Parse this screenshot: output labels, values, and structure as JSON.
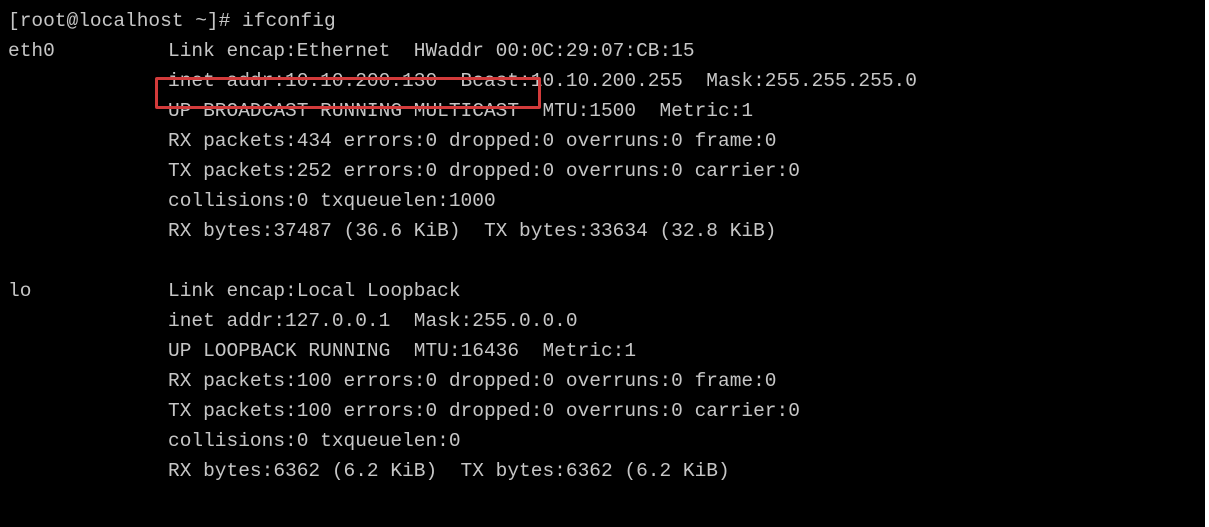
{
  "prompt": "[root@localhost ~]# ifconfig",
  "interfaces": [
    {
      "name": "eth0",
      "lines": [
        "Link encap:Ethernet  HWaddr 00:0C:29:07:CB:15",
        "inet addr:10.10.200.130  Bcast:10.10.200.255  Mask:255.255.255.0",
        "UP BROADCAST RUNNING MULTICAST  MTU:1500  Metric:1",
        "RX packets:434 errors:0 dropped:0 overruns:0 frame:0",
        "TX packets:252 errors:0 dropped:0 overruns:0 carrier:0",
        "collisions:0 txqueuelen:1000",
        "RX bytes:37487 (36.6 KiB)  TX bytes:33634 (32.8 KiB)"
      ]
    },
    {
      "name": "lo",
      "lines": [
        "Link encap:Local Loopback",
        "inet addr:127.0.0.1  Mask:255.0.0.0",
        "UP LOOPBACK RUNNING  MTU:16436  Metric:1",
        "RX packets:100 errors:0 dropped:0 overruns:0 frame:0",
        "TX packets:100 errors:0 dropped:0 overruns:0 carrier:0",
        "collisions:0 txqueuelen:0",
        "RX bytes:6362 (6.2 KiB)  TX bytes:6362 (6.2 KiB)"
      ]
    }
  ],
  "colors": {
    "background": "#000000",
    "text": "#c6c6c6",
    "highlight": "#d23b3b"
  }
}
